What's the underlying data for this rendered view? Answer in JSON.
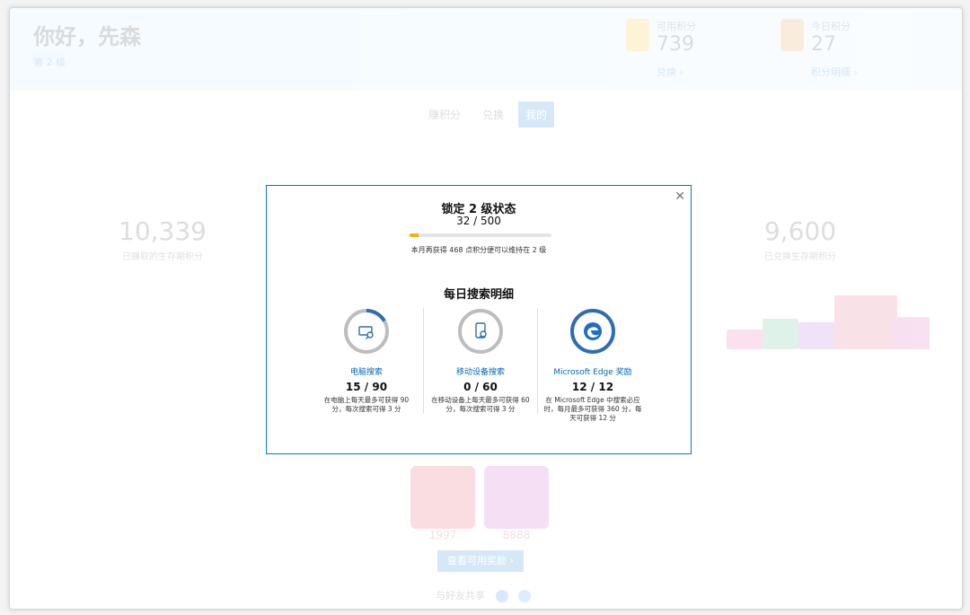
{
  "page": {
    "greeting": "你好，先森",
    "level": "第 2 级",
    "stats": [
      {
        "label": "可用积分",
        "value": "739",
        "link": "兑换 ›"
      },
      {
        "label": "今日积分",
        "value": "27",
        "link": "积分明细 ›"
      }
    ],
    "tabs": [
      "赚积分",
      "兑换",
      "我的"
    ],
    "left_big": {
      "value": "10,339",
      "label": "已赚取的生存期积分"
    },
    "right_big": {
      "value": "9,600",
      "label": "已兑换生存期积分"
    },
    "cards": [
      "1997",
      "8888"
    ],
    "cta": "查看可用奖励 ›",
    "share": "与好友共享"
  },
  "modal": {
    "title": "锁定 2 级状态",
    "progress_text": "32 / 500",
    "progress_fraction": 0.064,
    "note": "本月再获得 468 点积分便可以维持在 2 级",
    "details_title": "每日搜索明细",
    "items": [
      {
        "label": "电脑搜索",
        "value": "15 / 90",
        "note": "在电脑上每天最多可获得 90 分，每次搜索可得 3 分",
        "fraction": 0.1667,
        "icon": "pc-search-icon"
      },
      {
        "label": "移动设备搜索",
        "value": "0 / 60",
        "note": "在移动设备上每天最多可获得 60 分，每次搜索可得 3 分",
        "fraction": 0,
        "icon": "mobile-search-icon"
      },
      {
        "label": "Microsoft Edge 奖励",
        "value": "12 / 12",
        "note": "在 Microsoft Edge 中搜索必应时，每月最多可获得 360 分，每天可获得 12 分",
        "fraction": 1,
        "icon": "edge-logo-icon"
      }
    ]
  },
  "colors": {
    "accent": "#0078d4",
    "progress": "#f2b300",
    "ring_bg": "#bdbdbd",
    "ring_fg": "#2f6db3"
  }
}
